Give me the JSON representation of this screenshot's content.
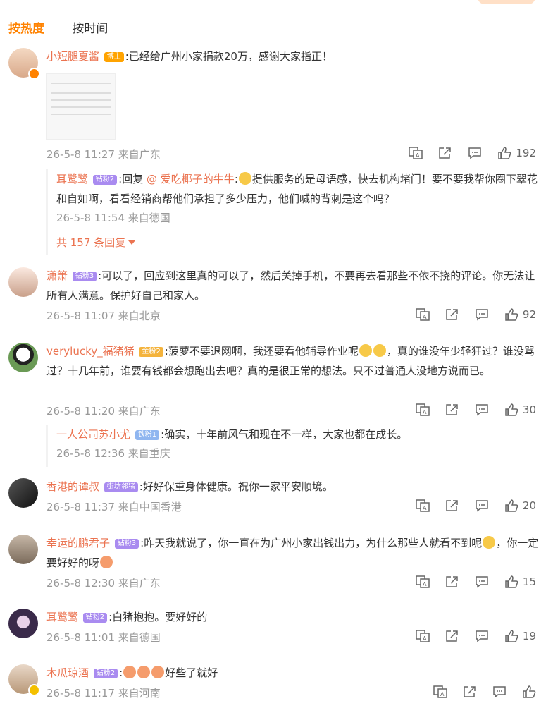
{
  "tabs": {
    "hot": "按热度",
    "time": "按时间"
  },
  "colors": {
    "accent": "#ff8200",
    "name": "#eb7350",
    "meta": "#999999"
  },
  "comments": [
    {
      "user": "小短腿夏酱",
      "badge": "博主",
      "sep": ":",
      "text": "已经给广州小家捐款20万，感谢大家指正！",
      "time": "26-5-8 11:27",
      "from": "来自广东",
      "likes": "192",
      "reply": {
        "user": "耳鹭鹭",
        "badge": "钻粉2",
        "sep": ":",
        "prefix": "回复",
        "mention": "@ 爱吃椰子的牛牛",
        "mention_sep": ":",
        "text": "提供服务的是母语感，快去机构堵门！要不要我帮你圈下翠花和自如啊，看看经销商帮他们承担了多少压力，他们喊的背刺是这个吗？",
        "time": "26-5-8 11:54",
        "from": "来自德国"
      },
      "more": "共 157 条回复"
    },
    {
      "user": "潇箫",
      "badge": "钻粉3",
      "sep": ":",
      "text": "可以了，回应到这里真的可以了，然后关掉手机，不要再去看那些不依不挠的评论。你无法让所有人满意。保护好自己和家人。",
      "time": "26-5-8 11:07",
      "from": "来自北京",
      "likes": "92"
    },
    {
      "user": "verylucky_福猪猪",
      "badge": "金粉2",
      "sep": ":",
      "text_a": "菠萝不要退网啊，我还要看他辅导作业呢",
      "text_b": "，真的谁没年少轻狂过？谁没骂过？十几年前，谁要有钱都会想跑出去吧？真的是很正常的想法。只不过普通人没地方说而已。",
      "time": "26-5-8 11:20",
      "from": "来自广东",
      "likes": "30",
      "reply": {
        "user": "一人公司苏小尤",
        "badge": "铁粉1",
        "sep": ":",
        "text": "确实，十年前风气和现在不一样，大家也都在成长。",
        "time": "26-5-8 12:36",
        "from": "来自重庆"
      }
    },
    {
      "user": "香港的谭叔",
      "badge": "街坊邻猪",
      "sep": ":",
      "text": "好好保重身体健康。祝你一家平安顺境。",
      "time": "26-5-8 11:37",
      "from": "来自中国香港",
      "likes": "20"
    },
    {
      "user": "幸运的鹏君子",
      "badge": "钻粉3",
      "sep": ":",
      "text_a": "昨天我就说了，你一直在为广州小家出钱出力，为什么那些人就看不到呢",
      "text_b": "，你一定要好好的呀",
      "time": "26-5-8 12:30",
      "from": "来自广东",
      "likes": "15"
    },
    {
      "user": "耳鹭鹭",
      "badge": "钻粉2",
      "sep": ":",
      "text": "白猪抱抱。要好好的",
      "time": "26-5-8 11:01",
      "from": "来自德国",
      "likes": "19"
    },
    {
      "user": "木瓜琼酒",
      "badge": "钻粉2",
      "sep": ":",
      "text": "好些了就好",
      "time": "26-5-8 11:17",
      "from": "来自河南"
    }
  ]
}
